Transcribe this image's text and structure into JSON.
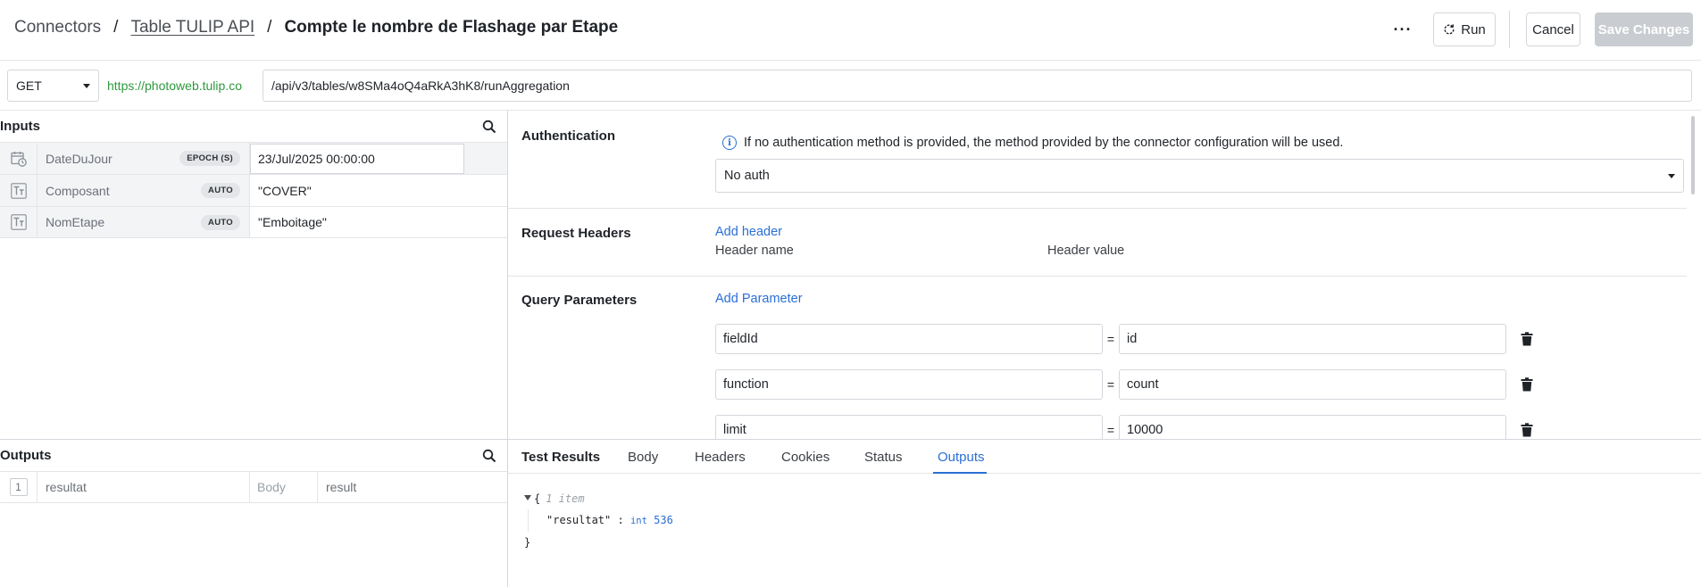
{
  "header": {
    "breadcrumb_root": "Connectors",
    "separator": "/",
    "breadcrumb_link": "Table TULIP API",
    "title": "Compte le nombre de Flashage par Etape",
    "more_label": "···",
    "run_label": "Run",
    "cancel_label": "Cancel",
    "save_label": "Save Changes"
  },
  "request": {
    "method": "GET",
    "base_url": "https://photoweb.tulip.co",
    "path": "/api/v3/tables/w8SMa4oQ4aRkA3hK8/runAggregation"
  },
  "inputs": {
    "title": "Inputs",
    "rows": [
      {
        "icon": "calendar-clock-icon",
        "name": "DateDuJour",
        "badge": "EPOCH (S)",
        "value": "23/Jul/2025 00:00:00"
      },
      {
        "icon": "text-type-icon",
        "name": "Composant",
        "badge": "AUTO",
        "value": "\"COVER\""
      },
      {
        "icon": "text-type-icon",
        "name": "NomEtape",
        "badge": "AUTO",
        "value": "\"Emboitage\""
      }
    ]
  },
  "outputs": {
    "title": "Outputs",
    "rows": [
      {
        "index": "1",
        "name": "resultat",
        "source": "Body",
        "path": "result"
      }
    ]
  },
  "config": {
    "auth_title": "Authentication",
    "auth_info": "If no authentication method is provided, the method provided by the connector configuration will be used.",
    "auth_value": "No auth",
    "headers_title": "Request Headers",
    "add_header": "Add header",
    "header_name_col": "Header name",
    "header_value_col": "Header value",
    "query_title": "Query Parameters",
    "add_parameter": "Add Parameter",
    "equals": "=",
    "params": [
      {
        "key": "fieldId",
        "value": "id"
      },
      {
        "key": "function",
        "value": "count"
      },
      {
        "key": "limit",
        "value": "10000"
      }
    ]
  },
  "results": {
    "title": "Test Results",
    "tabs": [
      "Body",
      "Headers",
      "Cookies",
      "Status",
      "Outputs"
    ],
    "active_tab": "Outputs",
    "json_open": "{",
    "json_meta": "1 item",
    "json_key": "\"resultat\"",
    "json_colon": ":",
    "json_type": "int",
    "json_value": "536",
    "json_close": "}"
  },
  "colors": {
    "accent": "#2b6fd6",
    "base_url": "#2e9a3e",
    "disabled_button": "#c9ccd1"
  }
}
